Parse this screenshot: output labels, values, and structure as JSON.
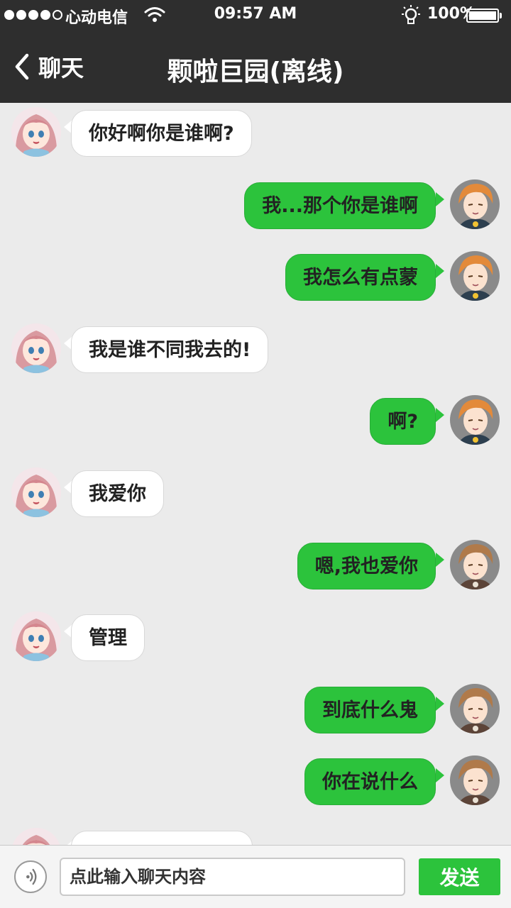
{
  "status_bar": {
    "signal_dots": 5,
    "signal_filled": 4,
    "carrier": "心动电信",
    "time": "09:57 AM",
    "battery_percent": "100%",
    "icons": [
      "signal-dots-icon",
      "wifi-icon",
      "lightbulb-icon",
      "battery-icon"
    ]
  },
  "nav": {
    "back_label": "聊天",
    "title": "颗啦巨园(离线)",
    "icons": [
      "chevron-left-icon"
    ]
  },
  "colors": {
    "header_bg": "#2e2e2e",
    "chat_bg": "#ebebeb",
    "outgoing_bubble": "#2cc33c",
    "incoming_bubble": "#ffffff",
    "send_button": "#2cc33c"
  },
  "messages": [
    {
      "side": "left",
      "avatar": "pink-hair-girl-avatar",
      "text": "你好啊你是谁啊?"
    },
    {
      "side": "right",
      "avatar": "orange-hair-boy-winking-avatar",
      "text": "我...那个你是谁啊"
    },
    {
      "side": "right",
      "avatar": "orange-hair-boy-winking-avatar",
      "text": "我怎么有点蒙"
    },
    {
      "side": "left",
      "avatar": "pink-hair-girl-avatar",
      "text": "我是谁不同我去的!"
    },
    {
      "side": "right",
      "avatar": "orange-hair-boy-winking-avatar",
      "text": "啊?"
    },
    {
      "side": "left",
      "avatar": "pink-hair-girl-avatar",
      "text": "我爱你"
    },
    {
      "side": "right",
      "avatar": "brown-hair-boy-avatar",
      "text": "嗯,我也爱你"
    },
    {
      "side": "left",
      "avatar": "pink-hair-girl-avatar",
      "text": "管理"
    },
    {
      "side": "right",
      "avatar": "brown-hair-boy-avatar",
      "text": "到底什么鬼"
    },
    {
      "side": "right",
      "avatar": "brown-hair-boy-avatar",
      "text": "你在说什么"
    },
    {
      "side": "left",
      "avatar": "pink-hair-girl-avatar",
      "text": ""
    }
  ],
  "input_bar": {
    "placeholder": "点此输入聊天内容",
    "value": "",
    "send_label": "发送",
    "icons": [
      "voice-icon"
    ]
  }
}
